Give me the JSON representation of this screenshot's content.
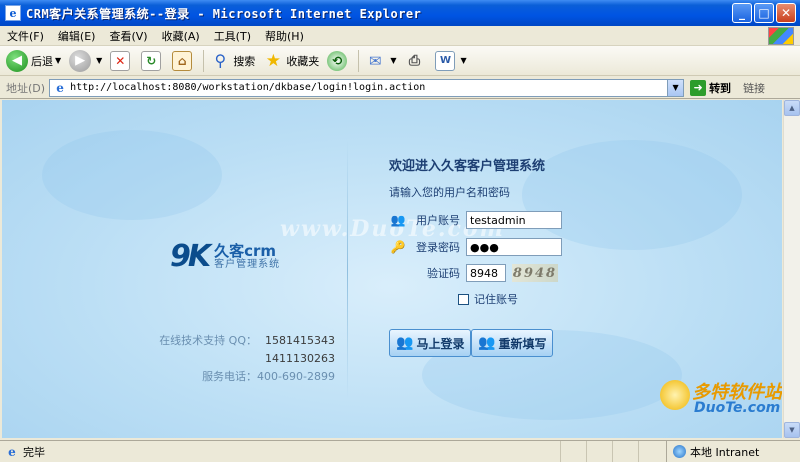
{
  "window": {
    "title": "CRM客户关系管理系统--登录 - Microsoft Internet Explorer",
    "buttons": {
      "minimize": "_",
      "maximize": "□",
      "close": "✕"
    }
  },
  "menu": [
    "文件(F)",
    "编辑(E)",
    "查看(V)",
    "收藏(A)",
    "工具(T)",
    "帮助(H)"
  ],
  "toolbar": {
    "back_label": "后退",
    "search_label": "搜索",
    "favorites_label": "收藏夹"
  },
  "address": {
    "label": "地址(D)",
    "url": "http://localhost:8080/workstation/dkbase/login!login.action",
    "go_label": "转到",
    "links_label": "链接"
  },
  "page": {
    "logo_mark": "9K",
    "logo_brand": "久客crm",
    "logo_sub": "客户管理系统",
    "support_label": "在线技术支持 QQ：",
    "qq1": "1581415343",
    "qq2": "1411130263",
    "phone": "服务电话：400-690-2899",
    "welcome": "欢迎进入久客客户管理系统",
    "hint": "请输入您的用户名和密码",
    "username_label": "用户账号",
    "username_value": "testadmin",
    "password_label": "登录密码",
    "password_value": "●●●",
    "captcha_label": "验证码",
    "captcha_value": "8948",
    "captcha_image_text": "8948",
    "remember_label": "记住账号",
    "login_button": "马上登录",
    "reset_button": "重新填写",
    "watermark": "www.DuoTe.com",
    "wm_brand": "多特软件站",
    "wm_domain": "DuoTe.com"
  },
  "status": {
    "text": "完毕",
    "zone": "本地 Intranet"
  }
}
